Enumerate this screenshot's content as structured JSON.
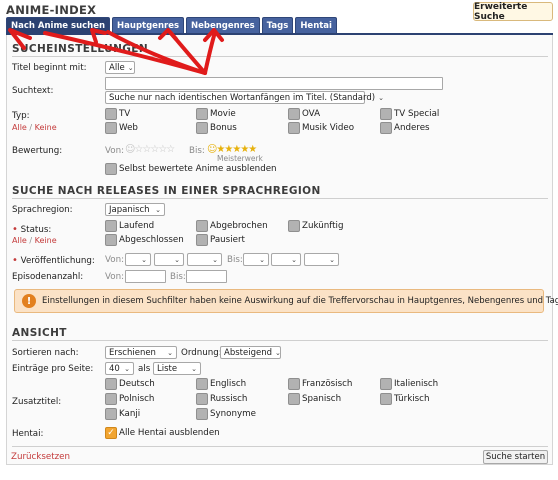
{
  "page": {
    "title": "ANIME-INDEX",
    "advanced_search": "Erweiterte Suche",
    "tabs": [
      "Nach Anime suchen",
      "Hauptgenres",
      "Nebengenres",
      "Tags",
      "Hentai"
    ]
  },
  "search": {
    "section": "SUCHEINSTELLUNGEN",
    "title_begins_label": "Titel beginnt mit:",
    "title_begins_value": "Alle",
    "searchtext_label": "Suchtext:",
    "searchtext_value": "",
    "searchtext_mode": "Suche nur nach identischen Wortanfängen im Titel. (Standard)",
    "type_label": "Typ:",
    "all_link": "Alle",
    "slash": "/",
    "none_link": "Keine",
    "types": [
      "TV",
      "Movie",
      "OVA",
      "TV Special",
      "Web",
      "Bonus",
      "Musik Video",
      "Anderes"
    ],
    "rating_label": "Bewertung:",
    "rating_from": "Von:",
    "rating_to": "Bis:",
    "rating_to_caption": "Meisterwerk",
    "hide_rated": "Selbst bewertete Anime ausblenden"
  },
  "releases": {
    "section": "SUCHE NACH RELEASES IN EINER SPRACHREGION",
    "region_label": "Sprachregion:",
    "region_value": "Japanisch",
    "status_label": "Status:",
    "statuses": [
      "Laufend",
      "Abgebrochen",
      "Zukünftig",
      "Abgeschlossen",
      "Pausiert"
    ],
    "publish_label": "Veröffentlichung:",
    "publish_from": "Von:",
    "publish_to": "Bis:",
    "episodes_label": "Episodenanzahl:",
    "episodes_from": "Von:",
    "episodes_to": "Bis:"
  },
  "notice": {
    "icon": "!",
    "text": "Einstellungen in diesem Suchfilter haben keine Auswirkung auf die Treffervorschau in Hauptgenres, Nebengenres und Tags."
  },
  "view": {
    "section": "ANSICHT",
    "sort_label": "Sortieren nach:",
    "sort_value": "Erschienen",
    "order_label": "Ordnung:",
    "order_value": "Absteigend",
    "per_page_label": "Einträge pro Seite:",
    "per_page_value": "40",
    "as_label": "als",
    "as_value": "Liste",
    "subtitles_label": "Zusatztitel:",
    "subtitles": [
      "Deutsch",
      "Englisch",
      "Französisch",
      "Italienisch",
      "Polnisch",
      "Russisch",
      "Spanisch",
      "Türkisch",
      "Kanji",
      "Synonyme"
    ],
    "hentai_label": "Hentai:",
    "hentai_option": "Alle Hentai ausblenden",
    "hentai_checked": true
  },
  "footer": {
    "reset": "Zurücksetzen",
    "search_button": "Suche starten"
  },
  "colors": {
    "tab_bg": "#46629e",
    "tab_active": "#2c4272",
    "accent_orange": "#f2a531",
    "link_red": "#c43b3b",
    "annotation_red": "#e01b1b"
  }
}
